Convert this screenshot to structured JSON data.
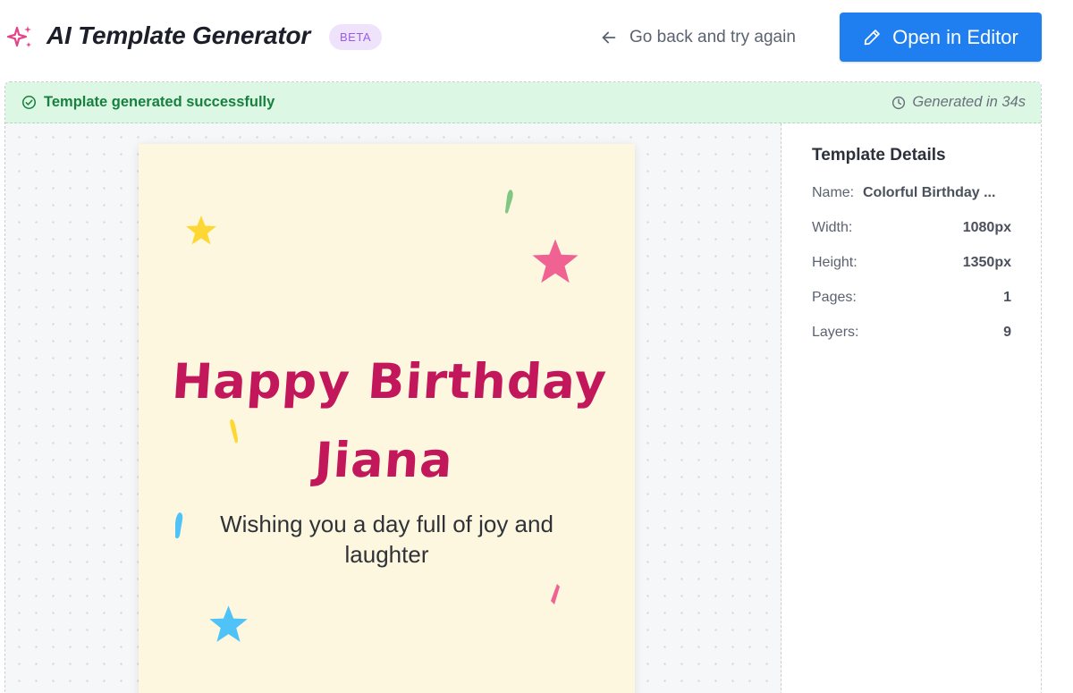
{
  "header": {
    "app_title": "AI Template Generator",
    "badge": "BETA",
    "back_link": "Go back and try again",
    "open_button": "Open in Editor"
  },
  "status": {
    "message": "Template generated successfully",
    "generated_time": "Generated in 34s"
  },
  "preview": {
    "title_line1": "Happy Birthday",
    "title_line2": "Jiana",
    "subtitle": "Wishing you a day full of joy and laughter"
  },
  "details": {
    "title": "Template Details",
    "rows": [
      {
        "label": "Name:",
        "value": "Colorful Birthday ..."
      },
      {
        "label": "Width:",
        "value": "1080px"
      },
      {
        "label": "Height:",
        "value": "1350px"
      },
      {
        "label": "Pages:",
        "value": "1"
      },
      {
        "label": "Layers:",
        "value": "9"
      }
    ]
  },
  "colors": {
    "accent_blue": "#1f7ff0",
    "success_green": "#18803f",
    "success_bg": "#dcf8e4",
    "beta_bg": "#efe3fb",
    "beta_text": "#9b5de5",
    "card_bg": "#fef7e0",
    "title_pink": "#c2185b"
  },
  "icons": {
    "logo": "sparkles-icon",
    "back": "arrow-left-icon",
    "open": "pencil-icon",
    "status_ok": "check-circle-icon",
    "status_time": "clock-icon"
  }
}
